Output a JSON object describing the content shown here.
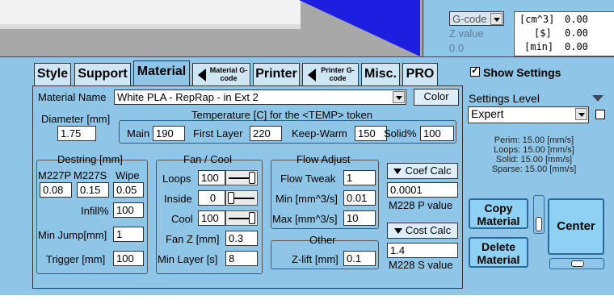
{
  "gcode_display": {
    "select_value": "G-code",
    "z_label": "Z value",
    "z_value": "0.0",
    "units": [
      "[cm^3]",
      "[$]",
      "[min]"
    ],
    "values": [
      "0.00",
      "0.00",
      "0.00"
    ]
  },
  "tabs": [
    {
      "label": "Style"
    },
    {
      "label": "Support"
    },
    {
      "label": "Material"
    },
    {
      "label": "Material G-code"
    },
    {
      "label": "Printer"
    },
    {
      "label": "Printer G-code"
    },
    {
      "label": "Misc."
    },
    {
      "label": "PRO"
    }
  ],
  "material": {
    "name_label": "Material Name",
    "name_value": "White PLA - RepRap - in Ext 2",
    "color_button": "Color",
    "diameter_label": "Diameter [mm]",
    "diameter_value": "1.75",
    "temp_title": "Temperature [C] for the <TEMP> token",
    "main_label": "Main",
    "main_value": "190",
    "first_layer_label": "First Layer",
    "first_layer_value": "220",
    "keep_warm_label": "Keep-Warm",
    "keep_warm_value": "150",
    "solid_label": "Solid%",
    "solid_value": "100"
  },
  "destring": {
    "title": "Destring [mm]",
    "col1": "M227P",
    "col2": "M227S",
    "col3": "Wipe",
    "v1": "0.08",
    "v2": "0.15",
    "v3": "0.05",
    "infill_label": "Infill%",
    "infill_value": "100",
    "min_jump_label": "Min Jump[mm]",
    "min_jump_value": "1",
    "trigger_label": "Trigger [mm]",
    "trigger_value": "100"
  },
  "fan": {
    "title": "Fan / Cool",
    "loops_label": "Loops",
    "loops_value": "100",
    "inside_label": "Inside",
    "inside_value": "0",
    "cool_label": "Cool",
    "cool_value": "100",
    "fanz_label": "Fan Z [mm]",
    "fanz_value": "0.3",
    "min_layer_label": "Min Layer [s]",
    "min_layer_value": "8"
  },
  "flow": {
    "title": "Flow Adjust",
    "tweak_label": "Flow Tweak",
    "tweak_value": "1",
    "min_label": "Min [mm^3/s]",
    "min_value": "0.01",
    "max_label": "Max [mm^3/s]",
    "max_value": "10",
    "coef_calc": "Coef Calc",
    "coef_value": "0.0001",
    "p_label": "M228 P value",
    "cost_calc": "Cost Calc",
    "cost_value": "1.4",
    "s_label": "M228 S value"
  },
  "other": {
    "title": "Other",
    "zlift_label": "Z-lift [mm]",
    "zlift_value": "0.1"
  },
  "settings": {
    "show_settings": "Show Settings",
    "level_label": "Settings Level",
    "level_value": "Expert",
    "speeds": [
      "Perim:  15.00 [mm/s]",
      "Loops:  15.00 [mm/s]",
      "Solid:  15.00 [mm/s]",
      "Sparse:  15.00 [mm/s]"
    ],
    "copy_material": "Copy Material",
    "delete_material": "Delete Material",
    "center": "Center"
  },
  "colors": {
    "panel": "#8fc6e7",
    "viewport_blue": "#1e1ee0"
  }
}
